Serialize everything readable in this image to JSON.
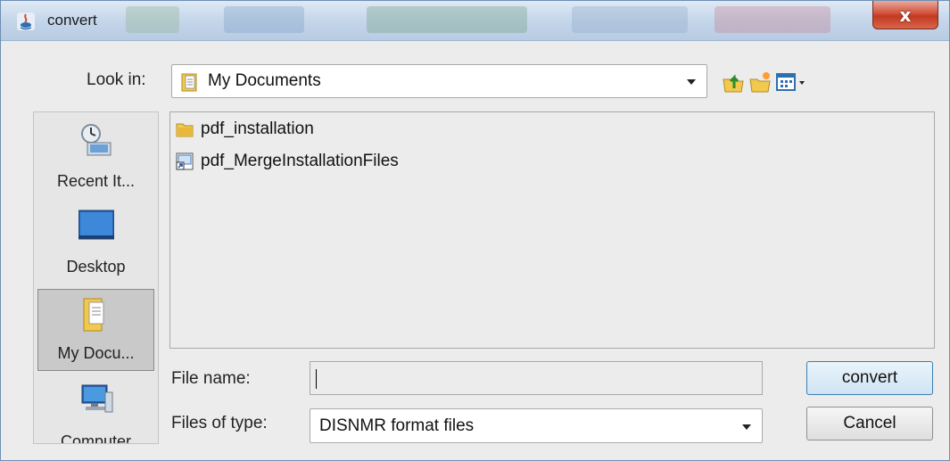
{
  "window": {
    "title": "convert"
  },
  "toolbar": {
    "look_in_label": "Look in:",
    "look_in_value": "My Documents",
    "icons": [
      "up-folder-icon",
      "new-folder-icon",
      "view-menu-icon"
    ]
  },
  "places": [
    {
      "label": "Recent It...",
      "icon": "recent-items-icon",
      "selected": false
    },
    {
      "label": "Desktop",
      "icon": "desktop-icon",
      "selected": false
    },
    {
      "label": "My Docu...",
      "icon": "my-documents-icon",
      "selected": true
    },
    {
      "label": "Computer",
      "icon": "computer-icon",
      "selected": false
    }
  ],
  "files": [
    {
      "name": "pdf_installation",
      "icon": "folder-icon"
    },
    {
      "name": "pdf_MergeInstallationFiles",
      "icon": "shortcut-icon"
    }
  ],
  "form": {
    "file_name_label": "File name:",
    "file_name_value": "",
    "file_type_label": "Files of type:",
    "file_type_value": "DISNMR format files"
  },
  "buttons": {
    "primary": "convert",
    "cancel": "Cancel"
  },
  "colors": {
    "accent": "#3c7fb1",
    "close": "#c23a22",
    "folder": "#f2c94c"
  }
}
